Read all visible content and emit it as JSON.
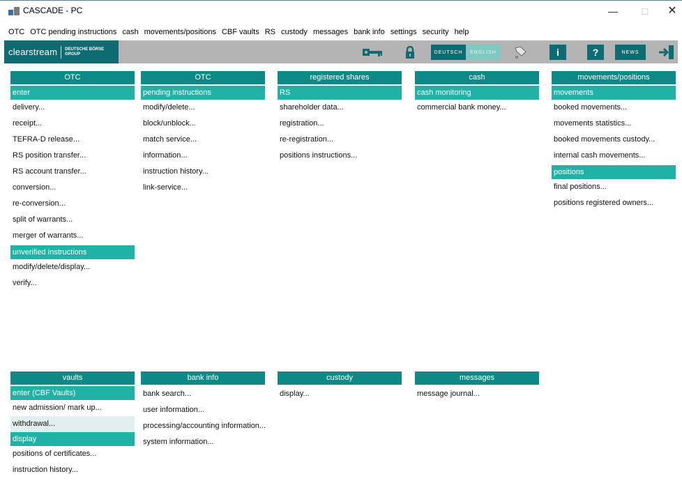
{
  "window": {
    "title": "CASCADE - PC",
    "minimize": "—",
    "maximize": "□",
    "close": "✕"
  },
  "menu": [
    "OTC",
    "OTC pending instructions",
    "cash",
    "movements/positions",
    "CBF vaults",
    "RS",
    "custody",
    "messages",
    "bank info",
    "settings",
    "security",
    "help"
  ],
  "toolbar": {
    "logo_main": "clearstream",
    "logo_sub_1": "DEUTSCHE BÖRSE",
    "logo_sub_2": "GROUP",
    "deutsch": "DEUTSCH",
    "english": "ENGLISH",
    "info": "i",
    "help": "?",
    "news": "NEWS"
  },
  "columns_top": [
    {
      "header": "OTC",
      "sections": [
        {
          "title": "enter",
          "items": [
            "delivery...",
            "receipt...",
            "TEFRA-D release...",
            "RS position transfer...",
            "RS account transfer...",
            "conversion...",
            "re-conversion...",
            "split of warrants...",
            "merger of warrants..."
          ]
        },
        {
          "title": "unverified instructions",
          "items": [
            "modify/delete/display...",
            "verify..."
          ]
        }
      ]
    },
    {
      "header": "OTC",
      "sections": [
        {
          "title": "pending instructions",
          "items": [
            "modify/delete...",
            "block/unblock...",
            "match service...",
            "information...",
            "instruction history...",
            "link-service..."
          ]
        }
      ]
    },
    {
      "header": "registered shares",
      "sections": [
        {
          "title": "RS",
          "items": [
            "shareholder data...",
            "registration...",
            "re-registration...",
            "positions instructions..."
          ]
        }
      ]
    },
    {
      "header": "cash",
      "sections": [
        {
          "title": "cash monitoring",
          "items": [
            "commercial bank money..."
          ]
        }
      ]
    },
    {
      "header": "movements/positions",
      "sections": [
        {
          "title": "movements",
          "items": [
            "booked movements...",
            "movements statistics...",
            "booked movements custody...",
            "internal cash movements..."
          ]
        },
        {
          "title": "positions",
          "items": [
            "final positions...",
            "positions registered owners..."
          ]
        }
      ]
    }
  ],
  "columns_bottom": [
    {
      "header": "vaults",
      "sections": [
        {
          "title": "enter (CBF Vaults)",
          "items": [
            "new admission/ mark up...",
            "withdrawal..."
          ]
        },
        {
          "title": "display",
          "items": [
            "positions of certificates...",
            "instruction history..."
          ]
        }
      ]
    },
    {
      "header": "bank info",
      "sections": [
        {
          "title": "",
          "items": [
            "bank search...",
            "user information...",
            "processing/accounting information...",
            "system information..."
          ]
        }
      ]
    },
    {
      "header": "custody",
      "sections": [
        {
          "title": "",
          "items": [
            "display..."
          ]
        }
      ]
    },
    {
      "header": "messages",
      "sections": [
        {
          "title": "",
          "items": [
            "message journal..."
          ]
        }
      ]
    }
  ],
  "colors": {
    "header": "#0c8a87",
    "section": "#1fb3a7",
    "toolbar": "#b4b4b4",
    "brand": "#0f6b72"
  }
}
